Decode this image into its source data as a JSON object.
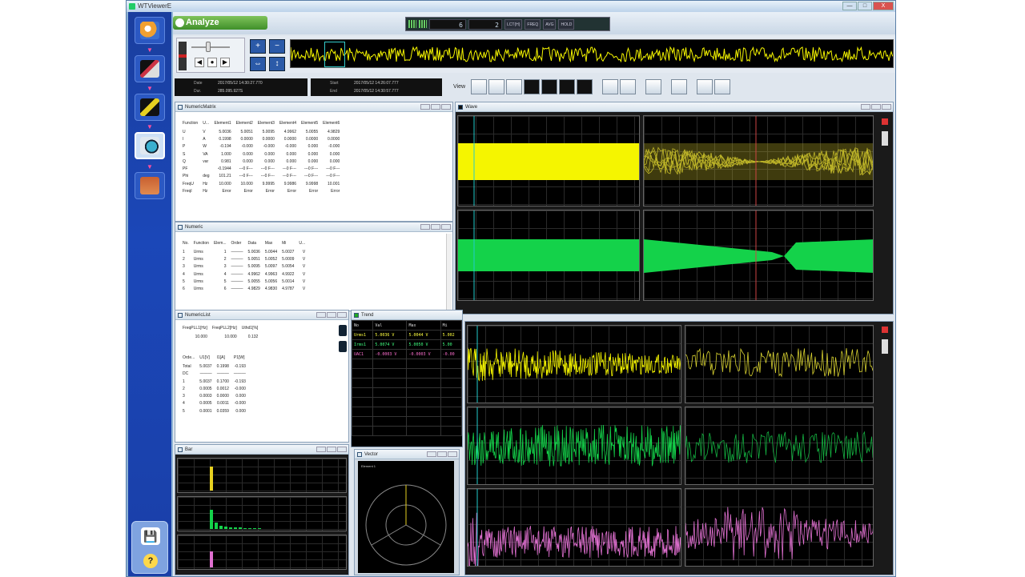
{
  "window": {
    "title": "WTViewerE",
    "buttons": [
      "—",
      "□",
      "X"
    ]
  },
  "sidebar": {
    "items": [
      {
        "name": "connect",
        "color": "#f0a030"
      },
      {
        "name": "measure",
        "color": "#cc3344"
      },
      {
        "name": "wave",
        "color": "#e6d020"
      },
      {
        "name": "analyze",
        "color": "#3ab0d0",
        "active": true
      },
      {
        "name": "report",
        "color": "#c86030"
      }
    ],
    "bottom": {
      "save": "💾",
      "help": "?"
    }
  },
  "toolbar": {
    "mode_label": "Analyze",
    "status": {
      "lcd1": "6",
      "lcd2": "2",
      "tags": [
        "LCT(H)",
        "FREQ",
        "AVG",
        "HOLD"
      ]
    }
  },
  "overview": {
    "left_label": "",
    "zoom": [
      "+",
      "−"
    ]
  },
  "info": {
    "date_label": "Date",
    "date_value": "2017/05/12 14:30:27.770",
    "dur_label": "Dur.",
    "dur_value": "285.095.927S",
    "start_label": "Start",
    "start_value": "2017/05/12 14:26:07.777",
    "end_label": "End",
    "end_value": "2017/05/12 14:30:57.777",
    "view_label": "View"
  },
  "numeric_matrix": {
    "title": "NumericMatrix",
    "columns": [
      "Function",
      "U...",
      "Element1",
      "Element2",
      "Element3",
      "Element4",
      "Element5",
      "Element6"
    ],
    "rows": [
      [
        "U",
        "V",
        "5.0036",
        "5.0051",
        "5.0095",
        "4.9962",
        "5.0055",
        "4.9829"
      ],
      [
        "I",
        "A",
        "0.1998",
        "0.0000",
        "0.0000",
        "0.0000",
        "0.0000",
        "0.0000"
      ],
      [
        "P",
        "W",
        "-0.194",
        "-0.000",
        "-0.000",
        "-0.000",
        "0.000",
        "-0.000"
      ],
      [
        "S",
        "VA",
        "1.000",
        "0.000",
        "0.000",
        "0.000",
        "0.000",
        "0.000"
      ],
      [
        "Q",
        "var",
        "0.981",
        "0.000",
        "0.000",
        "0.000",
        "0.000",
        "0.000"
      ],
      [
        "PF",
        "",
        "-0.1944",
        "---0 F---",
        "---0 F---",
        "---0 F---",
        "---0 F---",
        "---0 F---"
      ],
      [
        "Phi",
        "deg",
        "101.21",
        "---0 F---",
        "---0 F---",
        "---0 F---",
        "---0 F---",
        "---0 F---"
      ],
      [
        "FreqU",
        "Hz",
        "10.000",
        "10.000",
        "9.9995",
        "9.9986",
        "9.9998",
        "10.001"
      ],
      [
        "FreqI",
        "Hz",
        "Error",
        "Error",
        "Error",
        "Error",
        "Error",
        "Error"
      ]
    ]
  },
  "numeric": {
    "title": "Numeric",
    "columns": [
      "No.",
      "Function",
      "Elem...",
      "Order",
      "Data",
      "Max",
      "Mi",
      "U..."
    ],
    "rows": [
      [
        "1",
        "Urms",
        "1",
        "———",
        "5.0036",
        "5.0044",
        "5.0027",
        "V"
      ],
      [
        "2",
        "Urms",
        "2",
        "———",
        "5.0051",
        "5.0052",
        "5.0009",
        "V"
      ],
      [
        "3",
        "Urms",
        "3",
        "———",
        "5.0095",
        "5.0097",
        "5.0054",
        "V"
      ],
      [
        "4",
        "Urms",
        "4",
        "———",
        "4.9962",
        "4.9963",
        "4.9922",
        "V"
      ],
      [
        "5",
        "Urms",
        "5",
        "———",
        "5.0055",
        "5.0056",
        "5.0014",
        "V"
      ],
      [
        "6",
        "Urms",
        "6",
        "———",
        "4.9829",
        "4.9830",
        "4.9787",
        "V"
      ]
    ]
  },
  "numeric_list": {
    "title": "NumericList",
    "header": [
      "FreqPLL1[Hz]",
      "FreqPLL2[Hz]",
      "Uthd1[%]"
    ],
    "header_values": [
      "10.000",
      "10.000",
      "0.132"
    ],
    "columns": [
      "Orde...",
      "U1[V]",
      "I1[A]",
      "P1[W]"
    ],
    "rows": [
      [
        "Total",
        "5.0037",
        "0.1998",
        "-0.193"
      ],
      [
        "DC",
        "———",
        "———",
        "———"
      ],
      [
        "1",
        "5.0037",
        "0.1700",
        "-0.193"
      ],
      [
        "2",
        "0.0005",
        "0.0012",
        "-0.000"
      ],
      [
        "3",
        "0.0003",
        "0.0000",
        "0.000"
      ],
      [
        "4",
        "0.0005",
        "0.0011",
        "-0.000"
      ],
      [
        "5",
        "0.0001",
        "0.0359",
        "0.000"
      ]
    ]
  },
  "trend": {
    "title": "Trend",
    "columns": [
      "No",
      "Val",
      "Max",
      "Mi"
    ],
    "rows": [
      {
        "name": "Urms1",
        "val": "5.0036 V",
        "max": "5.0044 V",
        "min": "5.002",
        "color": "#ffff40"
      },
      {
        "name": "Irms1",
        "val": "5.0074 V",
        "max": "5.0050 V",
        "min": "5.00",
        "color": "#40ff80"
      },
      {
        "name": "UAC1",
        "val": "-0.0003 V",
        "max": "-0.0003 V",
        "min": "-0.00",
        "color": "#ff6fd0"
      }
    ]
  },
  "wave": {
    "title": "Wave"
  },
  "bar": {
    "title": "Bar"
  },
  "vector": {
    "title": "Vector",
    "element_label": "Element 1"
  },
  "colors": {
    "yellow": "#f5f500",
    "green": "#14d24a",
    "magenta": "#e070d0",
    "sidebar": "#1b47b8",
    "accent_green": "#5aa83a"
  }
}
